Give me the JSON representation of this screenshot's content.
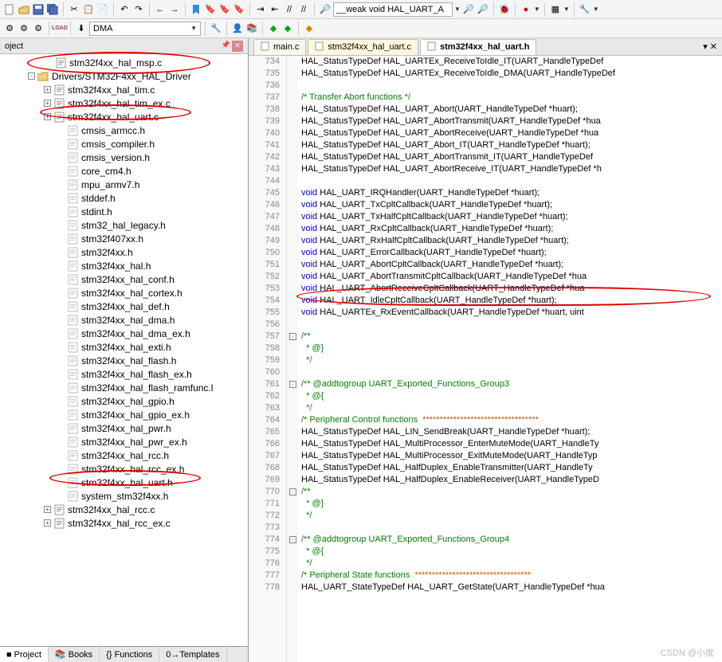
{
  "toolbar1": {
    "search_value": "__weak void HAL_UART_A"
  },
  "toolbar2": {
    "combo_value": "DMA"
  },
  "panel": {
    "title": "oject"
  },
  "tree": {
    "nodes": [
      {
        "indent": 55,
        "exp": "",
        "icon": "c",
        "label": "stm32f4xx_hal_msp.c"
      },
      {
        "indent": 35,
        "exp": "-",
        "icon": "folder",
        "label": "Drivers/STM32F4xx_HAL_Driver"
      },
      {
        "indent": 55,
        "exp": "+",
        "icon": "c",
        "label": "stm32f4xx_hal_tim.c"
      },
      {
        "indent": 55,
        "exp": "+",
        "icon": "c",
        "label": "stm32f4xx_hal_tim_ex.c"
      },
      {
        "indent": 55,
        "exp": "+",
        "icon": "c",
        "label": "stm32f4xx_hal_uart.c"
      },
      {
        "indent": 70,
        "exp": "",
        "icon": "h",
        "label": "cmsis_armcc.h"
      },
      {
        "indent": 70,
        "exp": "",
        "icon": "h",
        "label": "cmsis_compiler.h"
      },
      {
        "indent": 70,
        "exp": "",
        "icon": "h",
        "label": "cmsis_version.h"
      },
      {
        "indent": 70,
        "exp": "",
        "icon": "h",
        "label": "core_cm4.h"
      },
      {
        "indent": 70,
        "exp": "",
        "icon": "h",
        "label": "mpu_armv7.h"
      },
      {
        "indent": 70,
        "exp": "",
        "icon": "h",
        "label": "stddef.h"
      },
      {
        "indent": 70,
        "exp": "",
        "icon": "h",
        "label": "stdint.h"
      },
      {
        "indent": 70,
        "exp": "",
        "icon": "h",
        "label": "stm32_hal_legacy.h"
      },
      {
        "indent": 70,
        "exp": "",
        "icon": "h",
        "label": "stm32f407xx.h"
      },
      {
        "indent": 70,
        "exp": "",
        "icon": "h",
        "label": "stm32f4xx.h"
      },
      {
        "indent": 70,
        "exp": "",
        "icon": "h",
        "label": "stm32f4xx_hal.h"
      },
      {
        "indent": 70,
        "exp": "",
        "icon": "h",
        "label": "stm32f4xx_hal_conf.h"
      },
      {
        "indent": 70,
        "exp": "",
        "icon": "h",
        "label": "stm32f4xx_hal_cortex.h"
      },
      {
        "indent": 70,
        "exp": "",
        "icon": "h",
        "label": "stm32f4xx_hal_def.h"
      },
      {
        "indent": 70,
        "exp": "",
        "icon": "h",
        "label": "stm32f4xx_hal_dma.h"
      },
      {
        "indent": 70,
        "exp": "",
        "icon": "h",
        "label": "stm32f4xx_hal_dma_ex.h"
      },
      {
        "indent": 70,
        "exp": "",
        "icon": "h",
        "label": "stm32f4xx_hal_exti.h"
      },
      {
        "indent": 70,
        "exp": "",
        "icon": "h",
        "label": "stm32f4xx_hal_flash.h"
      },
      {
        "indent": 70,
        "exp": "",
        "icon": "h",
        "label": "stm32f4xx_hal_flash_ex.h"
      },
      {
        "indent": 70,
        "exp": "",
        "icon": "h",
        "label": "stm32f4xx_hal_flash_ramfunc.l"
      },
      {
        "indent": 70,
        "exp": "",
        "icon": "h",
        "label": "stm32f4xx_hal_gpio.h"
      },
      {
        "indent": 70,
        "exp": "",
        "icon": "h",
        "label": "stm32f4xx_hal_gpio_ex.h"
      },
      {
        "indent": 70,
        "exp": "",
        "icon": "h",
        "label": "stm32f4xx_hal_pwr.h"
      },
      {
        "indent": 70,
        "exp": "",
        "icon": "h",
        "label": "stm32f4xx_hal_pwr_ex.h"
      },
      {
        "indent": 70,
        "exp": "",
        "icon": "h",
        "label": "stm32f4xx_hal_rcc.h"
      },
      {
        "indent": 70,
        "exp": "",
        "icon": "h",
        "label": "stm32f4xx_hal_rcc_ex.h"
      },
      {
        "indent": 70,
        "exp": "",
        "icon": "h",
        "label": "stm32f4xx_hal_uart.h"
      },
      {
        "indent": 70,
        "exp": "",
        "icon": "h",
        "label": "system_stm32f4xx.h"
      },
      {
        "indent": 55,
        "exp": "+",
        "icon": "c",
        "label": "stm32f4xx_hal_rcc.c"
      },
      {
        "indent": 55,
        "exp": "+",
        "icon": "c",
        "label": "stm32f4xx_hal_rcc_ex.c"
      }
    ]
  },
  "bottom_tabs": [
    {
      "label": "Project",
      "icon": "■"
    },
    {
      "label": "Books",
      "icon": "📚"
    },
    {
      "label": "{} Functions",
      "icon": ""
    },
    {
      "label": "0→Templates",
      "icon": ""
    }
  ],
  "editor_tabs": [
    {
      "label": "main.c",
      "active": false,
      "style": ""
    },
    {
      "label": "stm32f4xx_hal_uart.c",
      "active": false,
      "style": "yellow"
    },
    {
      "label": "stm32f4xx_hal_uart.h",
      "active": true,
      "style": ""
    }
  ],
  "code": [
    {
      "n": 734,
      "t": "HAL_StatusTypeDef HAL_UARTEx_ReceiveToIdle_IT(UART_HandleTypeDef"
    },
    {
      "n": 735,
      "t": "HAL_StatusTypeDef HAL_UARTEx_ReceiveToIdle_DMA(UART_HandleTypeDef"
    },
    {
      "n": 736,
      "t": ""
    },
    {
      "n": 737,
      "t": "<cm>/* Transfer Abort functions */</cm>"
    },
    {
      "n": 738,
      "t": "HAL_StatusTypeDef HAL_UART_Abort(UART_HandleTypeDef *huart);"
    },
    {
      "n": 739,
      "t": "HAL_StatusTypeDef HAL_UART_AbortTransmit(UART_HandleTypeDef *hua"
    },
    {
      "n": 740,
      "t": "HAL_StatusTypeDef HAL_UART_AbortReceive(UART_HandleTypeDef *hua"
    },
    {
      "n": 741,
      "t": "HAL_StatusTypeDef HAL_UART_Abort_IT(UART_HandleTypeDef *huart);"
    },
    {
      "n": 742,
      "t": "HAL_StatusTypeDef HAL_UART_AbortTransmit_IT(UART_HandleTypeDef "
    },
    {
      "n": 743,
      "t": "HAL_StatusTypeDef HAL_UART_AbortReceive_IT(UART_HandleTypeDef *h"
    },
    {
      "n": 744,
      "t": ""
    },
    {
      "n": 745,
      "t": "<kw>void</kw> HAL_UART_IRQHandler(UART_HandleTypeDef *huart);"
    },
    {
      "n": 746,
      "t": "<kw>void</kw> HAL_UART_TxCpltCallback(UART_HandleTypeDef *huart);"
    },
    {
      "n": 747,
      "t": "<kw>void</kw> HAL_UART_TxHalfCpltCallback(UART_HandleTypeDef *huart);"
    },
    {
      "n": 748,
      "t": "<kw>void</kw> HAL_UART_RxCpltCallback(UART_HandleTypeDef *huart);"
    },
    {
      "n": 749,
      "t": "<kw>void</kw> HAL_UART_RxHalfCpltCallback(UART_HandleTypeDef *huart);"
    },
    {
      "n": 750,
      "t": "<kw>void</kw> HAL_UART_ErrorCallback(UART_HandleTypeDef *huart);"
    },
    {
      "n": 751,
      "t": "<kw>void</kw> HAL_UART_AbortCpltCallback(UART_HandleTypeDef *huart);"
    },
    {
      "n": 752,
      "t": "<kw>void</kw> HAL_UART_AbortTransmitCpltCallback(UART_HandleTypeDef *hua"
    },
    {
      "n": 753,
      "t": "<kw>void</kw> HAL_UART_AbortReceiveCpltCallback(UART_HandleTypeDef *hua"
    },
    {
      "n": 754,
      "t": "<kw>void</kw> HAL_UART_IdleCpltCallback(UART_HandleTypeDef *huart);"
    },
    {
      "n": 755,
      "t": "<kw>void</kw> HAL_UARTEx_RxEventCallback(UART_HandleTypeDef *huart, uint"
    },
    {
      "n": 756,
      "t": ""
    },
    {
      "n": 757,
      "fold": "-",
      "t": "<cm>/**</cm>"
    },
    {
      "n": 758,
      "t": "<cm>  * @}</cm>"
    },
    {
      "n": 759,
      "t": "<cm>  */</cm>"
    },
    {
      "n": 760,
      "t": ""
    },
    {
      "n": 761,
      "fold": "-",
      "t": "<cm>/** @addtogroup UART_Exported_Functions_Group3</cm>"
    },
    {
      "n": 762,
      "t": "<cm>  * @{</cm>"
    },
    {
      "n": 763,
      "t": "<cm>  */</cm>"
    },
    {
      "n": 764,
      "t": "<cm>/* Peripheral Control functions  </cm><star>**********************************</star>"
    },
    {
      "n": 765,
      "t": "HAL_StatusTypeDef HAL_LIN_SendBreak(UART_HandleTypeDef *huart);"
    },
    {
      "n": 766,
      "t": "HAL_StatusTypeDef HAL_MultiProcessor_EnterMuteMode(UART_HandleTy"
    },
    {
      "n": 767,
      "t": "HAL_StatusTypeDef HAL_MultiProcessor_ExitMuteMode(UART_HandleTyp"
    },
    {
      "n": 768,
      "t": "HAL_StatusTypeDef HAL_HalfDuplex_EnableTransmitter(UART_HandleTy"
    },
    {
      "n": 769,
      "t": "HAL_StatusTypeDef HAL_HalfDuplex_EnableReceiver(UART_HandleTypeD"
    },
    {
      "n": 770,
      "fold": "-",
      "t": "<cm>/**</cm>"
    },
    {
      "n": 771,
      "t": "<cm>  * @}</cm>"
    },
    {
      "n": 772,
      "t": "<cm>  */</cm>"
    },
    {
      "n": 773,
      "t": ""
    },
    {
      "n": 774,
      "fold": "-",
      "t": "<cm>/** @addtogroup UART_Exported_Functions_Group4</cm>"
    },
    {
      "n": 775,
      "t": "<cm>  * @{</cm>"
    },
    {
      "n": 776,
      "t": "<cm>  */</cm>"
    },
    {
      "n": 777,
      "t": "<cm>/* Peripheral State functions  </cm><star>**********************************</star>"
    },
    {
      "n": 778,
      "t": "HAL_UART_StateTypeDef HAL_UART_GetState(UART_HandleTypeDef *hua"
    }
  ],
  "watermark": "CSDN @小度"
}
